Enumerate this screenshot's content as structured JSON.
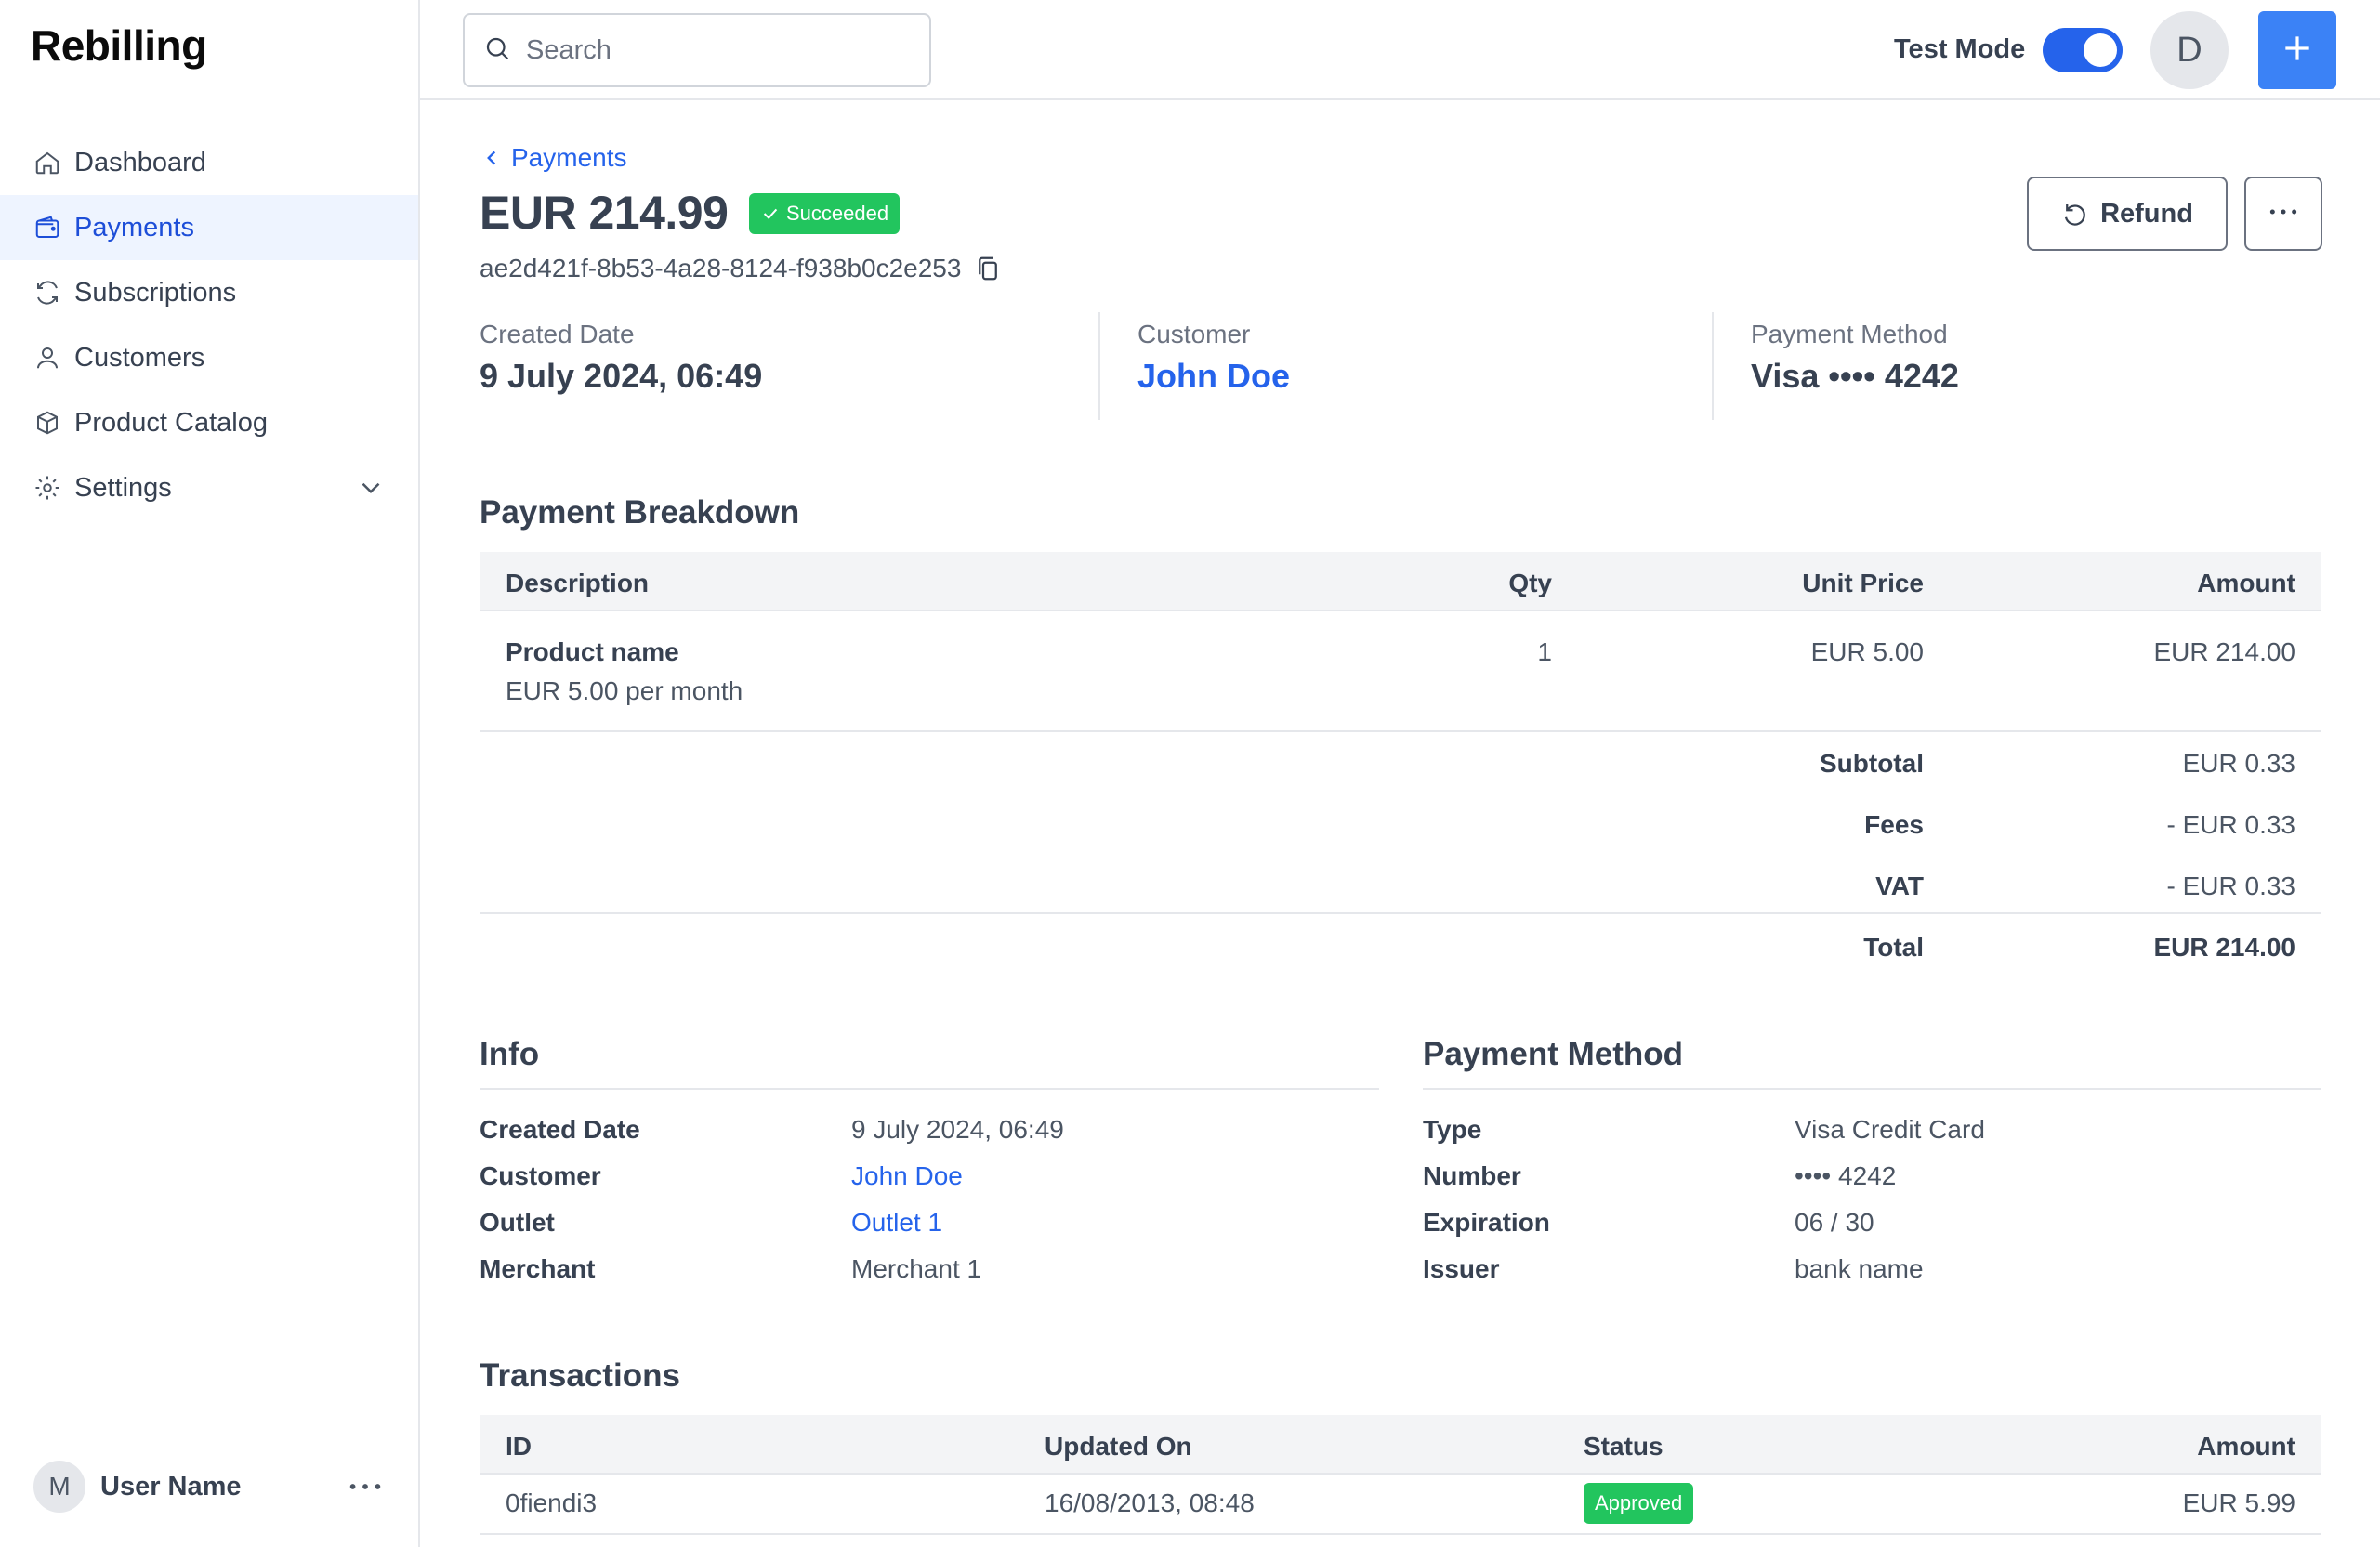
{
  "app": {
    "name": "Rebilling"
  },
  "sidebar": {
    "items": [
      {
        "label": "Dashboard",
        "icon": "home-icon"
      },
      {
        "label": "Payments",
        "icon": "wallet-icon",
        "active": true
      },
      {
        "label": "Subscriptions",
        "icon": "refresh-icon"
      },
      {
        "label": "Customers",
        "icon": "user-icon"
      },
      {
        "label": "Product Catalog",
        "icon": "box-icon"
      },
      {
        "label": "Settings",
        "icon": "gear-icon"
      }
    ],
    "user": {
      "initial": "M",
      "name": "User Name"
    }
  },
  "topbar": {
    "search_placeholder": "Search",
    "test_mode_label": "Test Mode",
    "test_mode_on": true,
    "avatar_initial": "D"
  },
  "payment": {
    "back_label": "Payments",
    "amount": "EUR 214.99",
    "status": "Succeeded",
    "id": "ae2d421f-8b53-4a28-8124-f938b0c2e253",
    "refund_label": "Refund",
    "summary": {
      "created_label": "Created Date",
      "created_value": "9 July 2024, 06:49",
      "customer_label": "Customer",
      "customer_value": "John Doe",
      "method_label": "Payment Method",
      "method_value": "Visa •••• 4242"
    }
  },
  "breakdown": {
    "title": "Payment Breakdown",
    "headers": {
      "description": "Description",
      "qty": "Qty",
      "unit_price": "Unit Price",
      "amount": "Amount"
    },
    "row": {
      "name": "Product name",
      "sub": "EUR 5.00 per month",
      "qty": "1",
      "unit_price": "EUR 5.00",
      "amount": "EUR 214.00"
    },
    "totals": {
      "subtotal_label": "Subtotal",
      "subtotal_value": "EUR 0.33",
      "fees_label": "Fees",
      "fees_value": "- EUR 0.33",
      "vat_label": "VAT",
      "vat_value": "- EUR 0.33",
      "total_label": "Total",
      "total_value": "EUR 214.00"
    }
  },
  "info": {
    "title": "Info",
    "created_label": "Created Date",
    "created_value": "9 July 2024, 06:49",
    "customer_label": "Customer",
    "customer_value": "John Doe",
    "outlet_label": "Outlet",
    "outlet_value": "Outlet 1",
    "merchant_label": "Merchant",
    "merchant_value": "Merchant 1"
  },
  "payment_method": {
    "title": "Payment Method",
    "type_label": "Type",
    "type_value": "Visa Credit Card",
    "number_label": "Number",
    "number_value": "•••• 4242",
    "expiration_label": "Expiration",
    "expiration_value": "06 / 30",
    "issuer_label": "Issuer",
    "issuer_value": "bank name"
  },
  "transactions": {
    "title": "Transactions",
    "headers": {
      "id": "ID",
      "updated_on": "Updated On",
      "status": "Status",
      "amount": "Amount"
    },
    "rows": [
      {
        "id": "0fiendi3",
        "updated_on": "16/08/2013, 08:48",
        "status": "Approved",
        "amount": "EUR 5.99"
      }
    ]
  },
  "colors": {
    "accent": "#2563eb",
    "success": "#22c55e",
    "button_primary": "#3b82f6"
  }
}
